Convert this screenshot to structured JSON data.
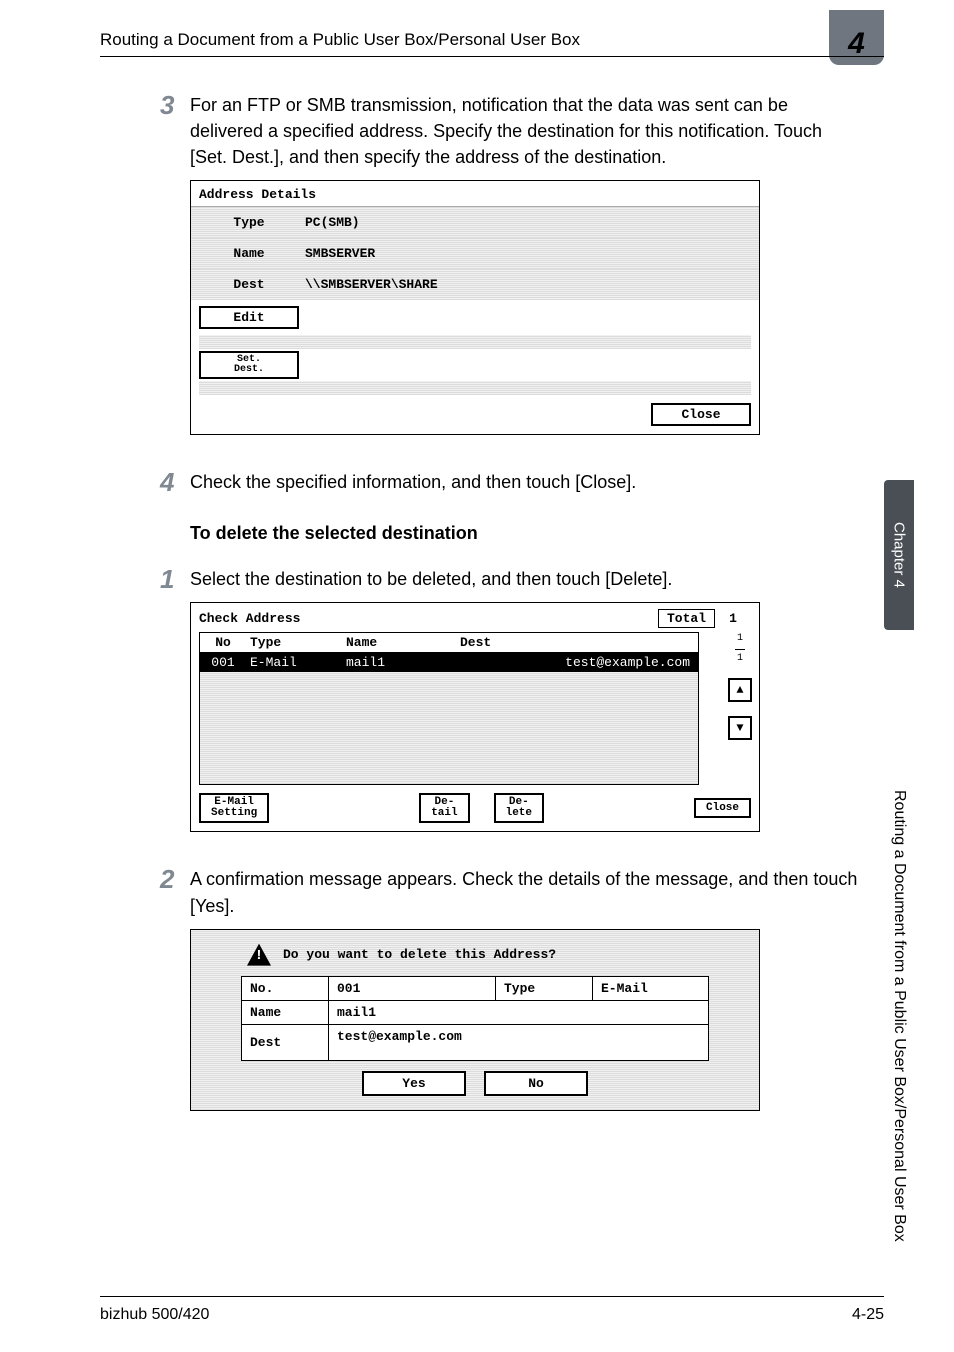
{
  "header": {
    "running_head": "Routing a Document from a Public User Box/Personal User Box",
    "chapter_badge": "4"
  },
  "steps": {
    "s3": {
      "num": "3",
      "text": "For an FTP or SMB transmission, notification that the data was sent can be delivered a specified address. Specify the destination for this notification. Touch [Set. Dest.], and then specify the address of the destination."
    },
    "s4": {
      "num": "4",
      "text": "Check the specified information, and then touch [Close]."
    },
    "delete_heading": "To delete the selected destination",
    "d1": {
      "num": "1",
      "text": "Select the destination to be deleted, and then touch [Delete]."
    },
    "d2": {
      "num": "2",
      "text": "A confirmation message appears. Check the details of the message, and then touch [Yes]."
    }
  },
  "sc1": {
    "title": "Address Details",
    "rows": {
      "type_label": "Type",
      "type_value": "PC(SMB)",
      "name_label": "Name",
      "name_value": "SMBSERVER",
      "dest_label": "Dest",
      "dest_value": "\\\\SMBSERVER\\SHARE"
    },
    "edit_btn": "Edit",
    "setdest_btn": "Set.\nDest.",
    "close_btn": "Close"
  },
  "sc2": {
    "title": "Check Address",
    "total_label": "Total",
    "total_value": "1",
    "columns": {
      "no": "No",
      "type": "Type",
      "name": "Name",
      "dest": "Dest"
    },
    "rows": [
      {
        "no": "001",
        "type": "E-Mail",
        "name": "mail1",
        "dest": "test@example.com"
      }
    ],
    "page_ind_top": "1",
    "page_ind_bot": "1",
    "emailsetting_btn": "E-Mail\nSetting",
    "detail_btn": "De-\ntail",
    "delete_btn": "De-\nlete",
    "close_btn": "Close"
  },
  "sc3": {
    "message": "Do you want to delete this Address?",
    "row1": {
      "no_label": "No.",
      "no_value": "001",
      "type_label": "Type",
      "type_value": "E-Mail"
    },
    "row2": {
      "name_label": "Name",
      "name_value": "mail1"
    },
    "row3": {
      "dest_label": "Dest",
      "dest_value": "test@example.com"
    },
    "yes": "Yes",
    "no": "No"
  },
  "side": {
    "tab": "Chapter 4",
    "text": "Routing a Document from a Public User Box/Personal User Box"
  },
  "footer": {
    "left": "bizhub 500/420",
    "right": "4-25"
  }
}
